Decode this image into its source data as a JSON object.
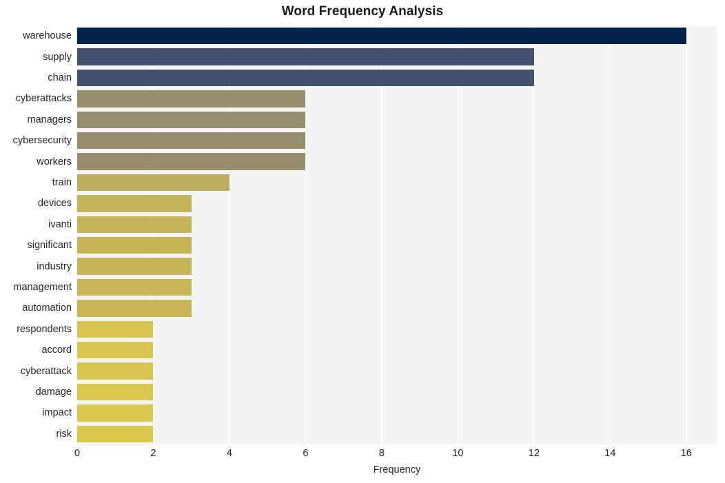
{
  "chart_data": {
    "type": "bar",
    "orientation": "horizontal",
    "title": "Word Frequency Analysis",
    "xlabel": "Frequency",
    "ylabel": "",
    "xlim": [
      0,
      16.8
    ],
    "ylim": [
      0,
      20
    ],
    "grid": true,
    "legend": null,
    "categories": [
      "warehouse",
      "supply",
      "chain",
      "cyberattacks",
      "managers",
      "cybersecurity",
      "workers",
      "train",
      "devices",
      "ivanti",
      "significant",
      "industry",
      "management",
      "automation",
      "respondents",
      "accord",
      "cyberattack",
      "damage",
      "impact",
      "risk"
    ],
    "values": [
      16,
      12,
      12,
      6,
      6,
      6,
      6,
      4,
      3,
      3,
      3,
      3,
      3,
      3,
      2,
      2,
      2,
      2,
      2,
      2
    ],
    "bar_colors": [
      "#02214b",
      "#434f6f",
      "#454f6e",
      "#978f6d",
      "#968f6d",
      "#968e6c",
      "#968e6c",
      "#bdad60",
      "#c5b35b",
      "#c6b45a",
      "#c6b459",
      "#c6b459",
      "#c7b558",
      "#c7b558",
      "#d8c552",
      "#d9c651",
      "#d9c650",
      "#dac74f",
      "#dbc84f",
      "#dbc84e"
    ],
    "xticks": [
      0,
      2,
      4,
      6,
      8,
      10,
      12,
      14,
      16
    ],
    "xtick_labels": [
      "0",
      "2",
      "4",
      "6",
      "8",
      "10",
      "12",
      "14",
      "16"
    ],
    "plot_background": "#f5f5f6",
    "gridline_color": "#ffffff",
    "figure_background": "#ffffff",
    "text_color": "#262626",
    "title_color": "#1a1a1a"
  }
}
